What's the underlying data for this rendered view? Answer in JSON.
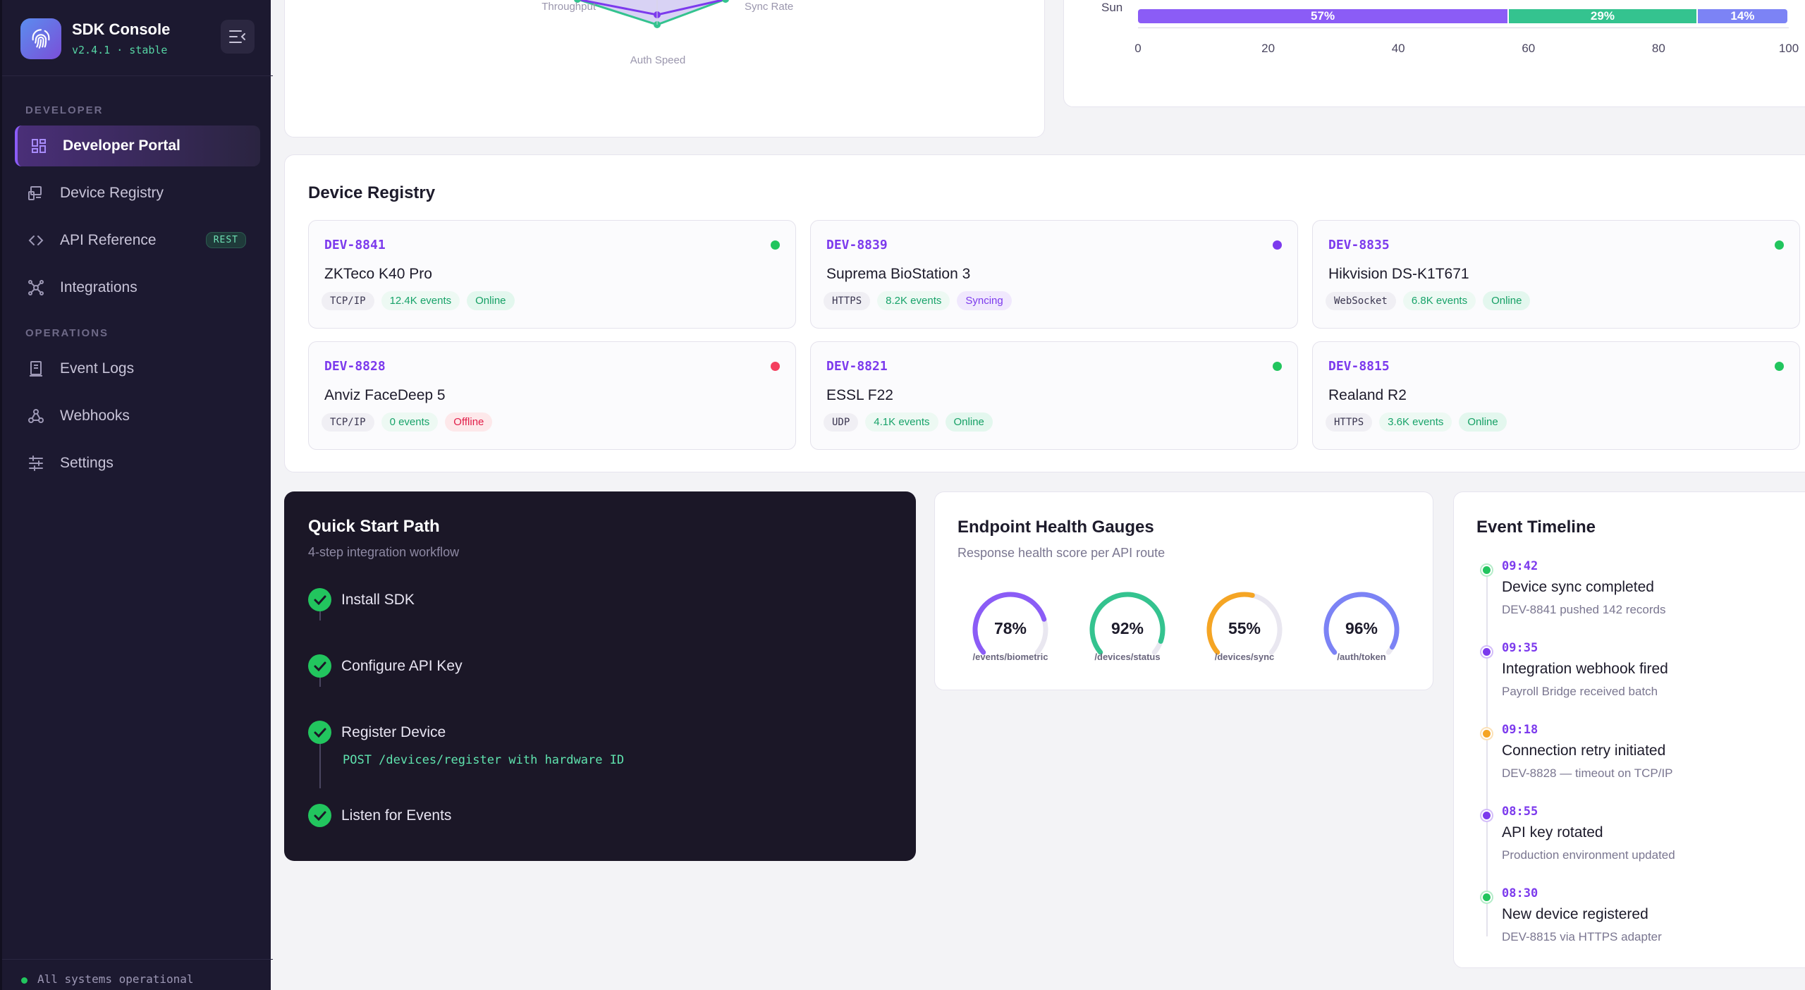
{
  "brand": {
    "name": "SDK Console",
    "version": "v2.4.1 · stable"
  },
  "sidebar": {
    "sections": [
      {
        "label": "DEVELOPER"
      },
      {
        "label": "OPERATIONS"
      }
    ],
    "items": [
      {
        "label": "Developer Portal",
        "icon": "dashboard-icon",
        "active": true
      },
      {
        "label": "Device Registry",
        "icon": "devices-icon"
      },
      {
        "label": "API Reference",
        "icon": "code-icon",
        "badge": "REST"
      },
      {
        "label": "Integrations",
        "icon": "integrations-icon"
      },
      {
        "label": "Event Logs",
        "icon": "log-icon"
      },
      {
        "label": "Webhooks",
        "icon": "webhook-icon"
      },
      {
        "label": "Settings",
        "icon": "sliders-icon"
      }
    ],
    "status": "All systems operational"
  },
  "radar": {
    "labels": [
      "Throughput",
      "Sync Rate",
      "Auth Speed"
    ]
  },
  "chart_data": {
    "type": "bar",
    "orientation": "horizontal-stacked",
    "categories": [
      "Sun"
    ],
    "series": [
      {
        "values": [
          57
        ],
        "label": "57%",
        "color": "#8b5cf6"
      },
      {
        "values": [
          29
        ],
        "label": "29%",
        "color": "#34c38f"
      },
      {
        "values": [
          14
        ],
        "label": "14%",
        "color": "#7c83f5"
      }
    ],
    "xlim": [
      0,
      100
    ],
    "xticks": [
      "0",
      "20",
      "40",
      "60",
      "80",
      "100"
    ]
  },
  "registry": {
    "title": "Device Registry",
    "devices": [
      {
        "id": "DEV-8841",
        "name": "ZKTeco K40 Pro",
        "protocol": "TCP/IP",
        "events": "12.4K events",
        "status": "Online",
        "dot": "#22c55e"
      },
      {
        "id": "DEV-8839",
        "name": "Suprema BioStation 3",
        "protocol": "HTTPS",
        "events": "8.2K events",
        "status": "Syncing",
        "dot": "#7c3aed"
      },
      {
        "id": "DEV-8835",
        "name": "Hikvision DS-K1T671",
        "protocol": "WebSocket",
        "events": "6.8K events",
        "status": "Online",
        "dot": "#22c55e"
      },
      {
        "id": "DEV-8828",
        "name": "Anviz FaceDeep 5",
        "protocol": "TCP/IP",
        "events": "0 events",
        "status": "Offline",
        "dot": "#f43f5e"
      },
      {
        "id": "DEV-8821",
        "name": "ESSL F22",
        "protocol": "UDP",
        "events": "4.1K events",
        "status": "Online",
        "dot": "#22c55e"
      },
      {
        "id": "DEV-8815",
        "name": "Realand R2",
        "protocol": "HTTPS",
        "events": "3.6K events",
        "status": "Online",
        "dot": "#22c55e"
      }
    ]
  },
  "quickstart": {
    "title": "Quick Start Path",
    "subtitle": "4-step integration workflow",
    "steps": [
      {
        "label": "Install SDK"
      },
      {
        "label": "Configure API Key"
      },
      {
        "label": "Register Device"
      },
      {
        "label": "Listen for Events"
      }
    ],
    "code": "POST /devices/register with hardware ID"
  },
  "gauges": {
    "title": "Endpoint Health Gauges",
    "subtitle": "Response health score per API route",
    "items": [
      {
        "value": "78%",
        "pct": 78,
        "route": "/events/biometric",
        "color": "#8b5cf6"
      },
      {
        "value": "92%",
        "pct": 92,
        "route": "/devices/status",
        "color": "#34c38f"
      },
      {
        "value": "55%",
        "pct": 55,
        "route": "/devices/sync",
        "color": "#f5a524"
      },
      {
        "value": "96%",
        "pct": 96,
        "route": "/auth/token",
        "color": "#7c83f5"
      }
    ]
  },
  "timeline": {
    "title": "Event Timeline",
    "events": [
      {
        "time": "09:42",
        "title": "Device sync completed",
        "desc": "DEV-8841 pushed 142 records",
        "color": "#22c55e"
      },
      {
        "time": "09:35",
        "title": "Integration webhook fired",
        "desc": "Payroll Bridge received batch",
        "color": "#7c3aed"
      },
      {
        "time": "09:18",
        "title": "Connection retry initiated",
        "desc": "DEV-8828 — timeout on TCP/IP",
        "color": "#f5a524"
      },
      {
        "time": "08:55",
        "title": "API key rotated",
        "desc": "Production environment updated",
        "color": "#7c3aed"
      },
      {
        "time": "08:30",
        "title": "New device registered",
        "desc": "DEV-8815 via HTTPS adapter",
        "color": "#22c55e"
      }
    ]
  }
}
